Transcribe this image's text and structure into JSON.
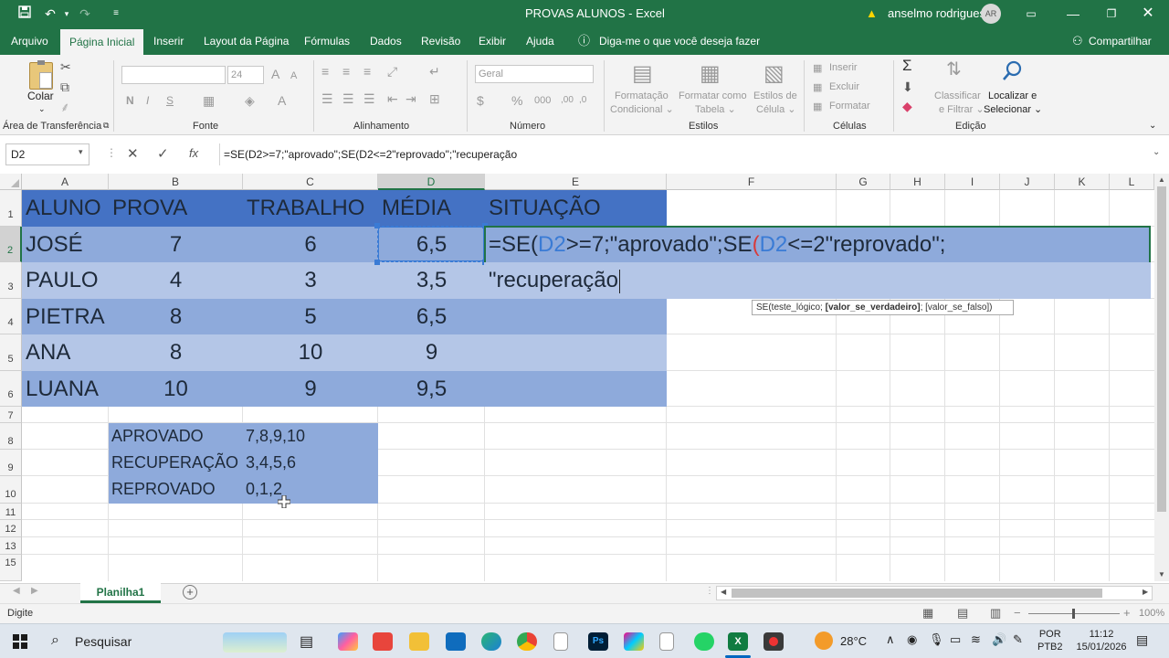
{
  "titlebar": {
    "title": "PROVAS ALUNOS  -  Excel",
    "user": "anselmo rodrigues",
    "avatar_initials": "AR",
    "warning_icon": "warning-icon"
  },
  "menu": {
    "tabs": [
      "Arquivo",
      "Página Inicial",
      "Inserir",
      "Layout da Página",
      "Fórmulas",
      "Dados",
      "Revisão",
      "Exibir",
      "Ajuda"
    ],
    "tell_me": "Diga-me o que você deseja fazer",
    "share": "Compartilhar"
  },
  "ribbon": {
    "paste_label": "Colar",
    "font_size": "24",
    "number_format": "Geral",
    "cond_format": "Formatação",
    "cond_format_2": "Condicional ⌄",
    "format_table": "Formatar como",
    "format_table_2": "Tabela ⌄",
    "cell_styles": "Estilos de",
    "cell_styles_2": "Célula ⌄",
    "insert": "Inserir",
    "delete": "Excluir",
    "format": "Formatar",
    "sort_filter": "Classificar",
    "sort_filter_2": "e Filtrar ⌄",
    "find_select": "Localizar e",
    "find_select_2": "Selecionar ⌄",
    "groups": {
      "clipboard": "Área de Transferência",
      "font": "Fonte",
      "alignment": "Alinhamento",
      "number": "Número",
      "styles": "Estilos",
      "cells": "Células",
      "editing": "Edição"
    }
  },
  "formula_bar": {
    "name_box": "D2",
    "formula": "=SE(D2>=7;\"aprovado\";SE(D2<=2\"reprovado\";\"recuperação"
  },
  "grid": {
    "columns": [
      "A",
      "B",
      "C",
      "D",
      "E",
      "F",
      "G",
      "H",
      "I",
      "J",
      "K",
      "L"
    ],
    "rows": [
      "1",
      "2",
      "3",
      "4",
      "5",
      "6",
      "7",
      "8",
      "9",
      "10",
      "11",
      "12",
      "13",
      "15"
    ],
    "header": [
      "ALUNO",
      "PROVA",
      "TRABALHO",
      "MÉDIA",
      "SITUAÇÃO"
    ],
    "students": [
      {
        "name": "JOSÉ",
        "prova": "7",
        "trabalho": "6",
        "media": "6,5"
      },
      {
        "name": "PAULO",
        "prova": "4",
        "trabalho": "3",
        "media": "3,5"
      },
      {
        "name": "PIETRA",
        "prova": "8",
        "trabalho": "5",
        "media": "6,5"
      },
      {
        "name": "ANA",
        "prova": "8",
        "trabalho": "10",
        "media": "9"
      },
      {
        "name": "LUANA",
        "prova": "10",
        "trabalho": "9",
        "media": "9,5"
      }
    ],
    "editing_formula": {
      "p1": "=SE(",
      "ref1": "D2",
      "p2": ">=7;\"aprovado\";SE",
      "paren": "(",
      "ref2": "D2",
      "p3": "<=2\"reprovado\";",
      "line2": "\"recuperação"
    },
    "tooltip": {
      "prefix": "SE(teste_lógico; ",
      "bold": "[valor_se_verdadeiro]",
      "suffix": "; [valor_se_falso])"
    },
    "legend": [
      {
        "label": "APROVADO",
        "values": "7,8,9,10"
      },
      {
        "label": "RECUPERAÇÃO",
        "values": "3,4,5,6"
      },
      {
        "label": "REPROVADO",
        "values": "0,1,2"
      }
    ]
  },
  "sheets": {
    "active": "Planilha1"
  },
  "status": {
    "mode": "Digite",
    "zoom": "100%"
  },
  "taskbar": {
    "search": "Pesquisar",
    "weather": "28°C",
    "lang1": "POR",
    "lang2": "PTB2",
    "time": "11:12",
    "date": "15/01/2026"
  },
  "colors": {
    "excel_green": "#217346",
    "header_fill": "#4472c4",
    "row_dark": "#8eaadb",
    "row_light": "#b4c6e7",
    "ref_blue": "#3a7bd5",
    "paren_red": "#d83b3b"
  }
}
